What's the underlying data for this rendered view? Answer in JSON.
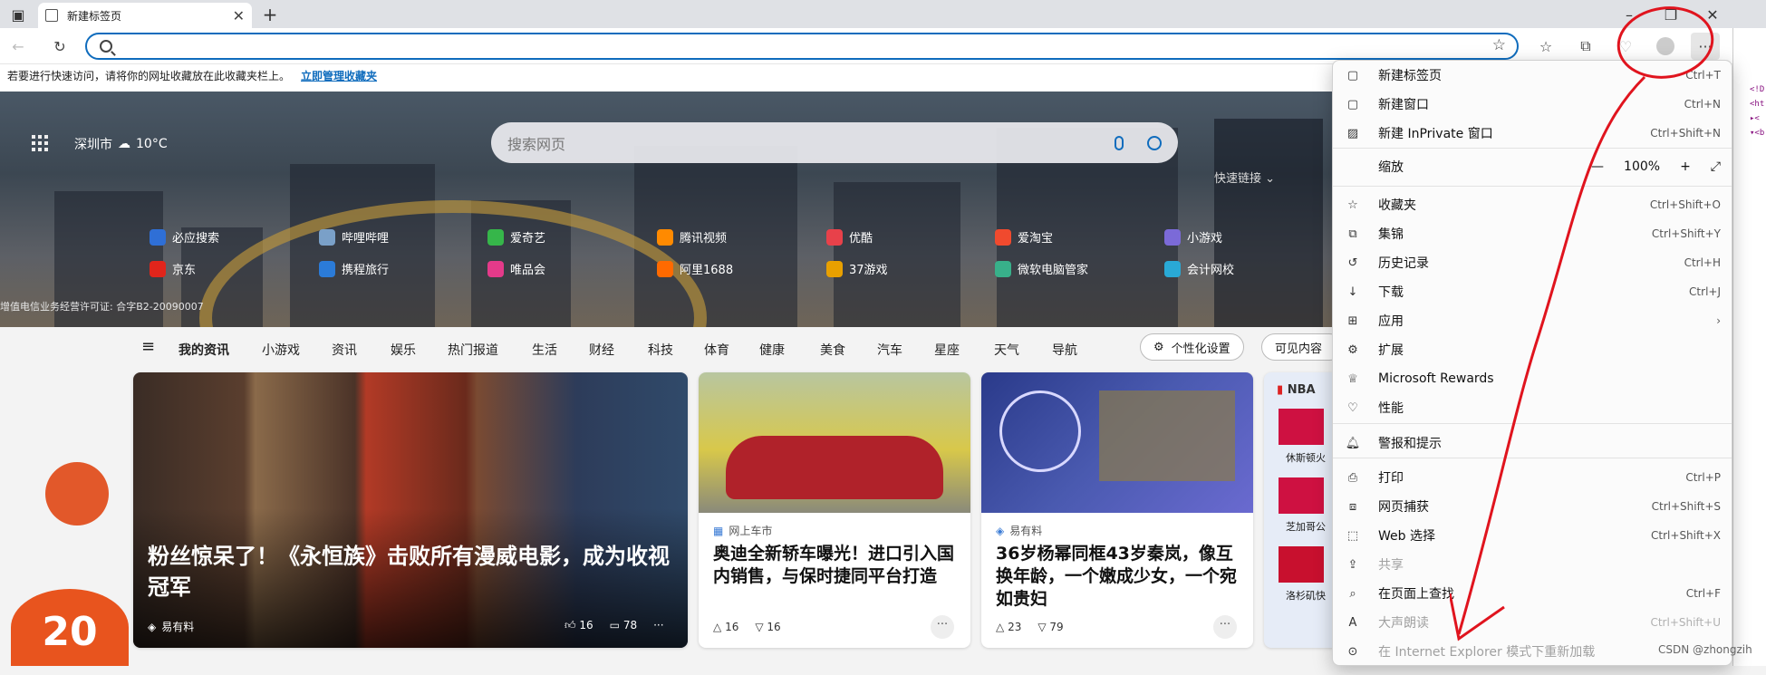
{
  "tab": {
    "title": "新建标签页",
    "close": "✕",
    "new_tab": "+"
  },
  "window": {
    "minimize": "–",
    "restore": "❐",
    "close": "✕"
  },
  "addressbar": {
    "value": "",
    "placeholder": ""
  },
  "favbar": {
    "text": "若要进行快速访问，请将你的网址收藏放在此收藏夹栏上。",
    "link": "立即管理收藏夹"
  },
  "hero": {
    "city": "深圳市",
    "temp": "10°C",
    "search_placeholder": "搜索网页",
    "quicklinks_label": "快速链接",
    "icp": "增值电信业务经营许可证: 合字B2-20090007",
    "links": [
      {
        "label": "必应搜索",
        "color": "#2f6fd6"
      },
      {
        "label": "哔哩哔哩",
        "color": "#7aa0c8"
      },
      {
        "label": "爱奇艺",
        "color": "#36b64a"
      },
      {
        "label": "腾讯视频",
        "color": "#ff8a00"
      },
      {
        "label": "优酷",
        "color": "#e8414a"
      },
      {
        "label": "爱淘宝",
        "color": "#f04a2e"
      },
      {
        "label": "小游戏",
        "color": "#7b6ad8"
      },
      {
        "label": "京东",
        "color": "#e1251b"
      },
      {
        "label": "携程旅行",
        "color": "#2b7bd8"
      },
      {
        "label": "唯品会",
        "color": "#e43a8a"
      },
      {
        "label": "阿里1688",
        "color": "#ff6a00"
      },
      {
        "label": "37游戏",
        "color": "#e8a000"
      },
      {
        "label": "微软电脑管家",
        "color": "#38b08a"
      },
      {
        "label": "会计网校",
        "color": "#29a9d6"
      }
    ]
  },
  "newsnav": {
    "tabs": [
      "我的资讯",
      "小游戏",
      "资讯",
      "娱乐",
      "热门报道",
      "生活",
      "财经",
      "科技",
      "体育",
      "健康",
      "美食",
      "汽车",
      "星座",
      "天气",
      "导航"
    ],
    "personalize": "个性化设置",
    "visible": "可见内容"
  },
  "cards": {
    "main": {
      "title": "粉丝惊呆了！《永恒族》击败所有漫威电影，成为收视冠军",
      "source": "易有料",
      "likes": "16",
      "comments": "78"
    },
    "audi": {
      "source": "网上车市",
      "title": "奥迪全新轿车曝光！进口引入国内销售，与保时捷同平台打造",
      "likes": "16",
      "dislikes": "16"
    },
    "yang": {
      "source": "易有料",
      "title": "36岁杨幂同框43岁秦岚，像互换年龄，一个嫩成少女，一个宛如贵妇",
      "likes": "23",
      "dislikes": "79"
    },
    "nba": {
      "label": "NBA",
      "teams": [
        "休斯顿火",
        "芝加哥公",
        "洛杉矶快"
      ]
    }
  },
  "menu": {
    "items": [
      {
        "label": "新建标签页",
        "shortcut": "Ctrl+T"
      },
      {
        "label": "新建窗口",
        "shortcut": "Ctrl+N"
      },
      {
        "label": "新建 InPrivate 窗口",
        "shortcut": "Ctrl+Shift+N"
      },
      {
        "label": "缩放",
        "zoom": "100%"
      },
      {
        "label": "收藏夹",
        "shortcut": "Ctrl+Shift+O"
      },
      {
        "label": "集锦",
        "shortcut": "Ctrl+Shift+Y"
      },
      {
        "label": "历史记录",
        "shortcut": "Ctrl+H"
      },
      {
        "label": "下载",
        "shortcut": "Ctrl+J"
      },
      {
        "label": "应用",
        "shortcut": "›"
      },
      {
        "label": "扩展",
        "shortcut": ""
      },
      {
        "label": "Microsoft Rewards",
        "shortcut": ""
      },
      {
        "label": "性能",
        "shortcut": ""
      },
      {
        "label": "警报和提示",
        "shortcut": ""
      },
      {
        "label": "打印",
        "shortcut": "Ctrl+P"
      },
      {
        "label": "网页捕获",
        "shortcut": "Ctrl+Shift+S"
      },
      {
        "label": "Web 选择",
        "shortcut": "Ctrl+Shift+X"
      },
      {
        "label": "共享",
        "shortcut": ""
      },
      {
        "label": "在页面上查找",
        "shortcut": "Ctrl+F"
      },
      {
        "label": "大声朗读",
        "shortcut": "Ctrl+Shift+U"
      },
      {
        "label": "在 Internet Explorer 模式下重新加载",
        "shortcut": ""
      }
    ]
  },
  "watermark": "CSDN @zhongzih",
  "colors": {
    "accent": "#0f6cbd",
    "annotation": "#e0141e"
  }
}
